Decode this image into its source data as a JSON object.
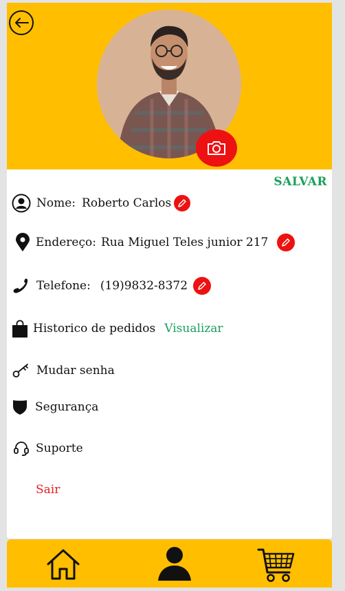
{
  "header": {
    "back_icon": "arrow-left-icon",
    "camera_icon": "camera-icon",
    "accent": "#ffbe00"
  },
  "actions": {
    "save_label": "SALVAR"
  },
  "fields": {
    "name": {
      "label": "Nome:",
      "value": "Roberto Carlos"
    },
    "address": {
      "label": "Endereço:",
      "value": "Rua Miguel Teles junior 217"
    },
    "phone": {
      "label": "Telefone:",
      "value": "(19)9832-8372"
    }
  },
  "menu": {
    "orders": {
      "label": "Historico de pedidos",
      "link": "Visualizar"
    },
    "password": {
      "label": "Mudar senha"
    },
    "security": {
      "label": "Segurança"
    },
    "support": {
      "label": "Suporte"
    },
    "logout": {
      "label": "Sair"
    }
  },
  "bottom_nav": {
    "items": [
      "home-icon",
      "profile-icon",
      "cart-icon"
    ]
  }
}
